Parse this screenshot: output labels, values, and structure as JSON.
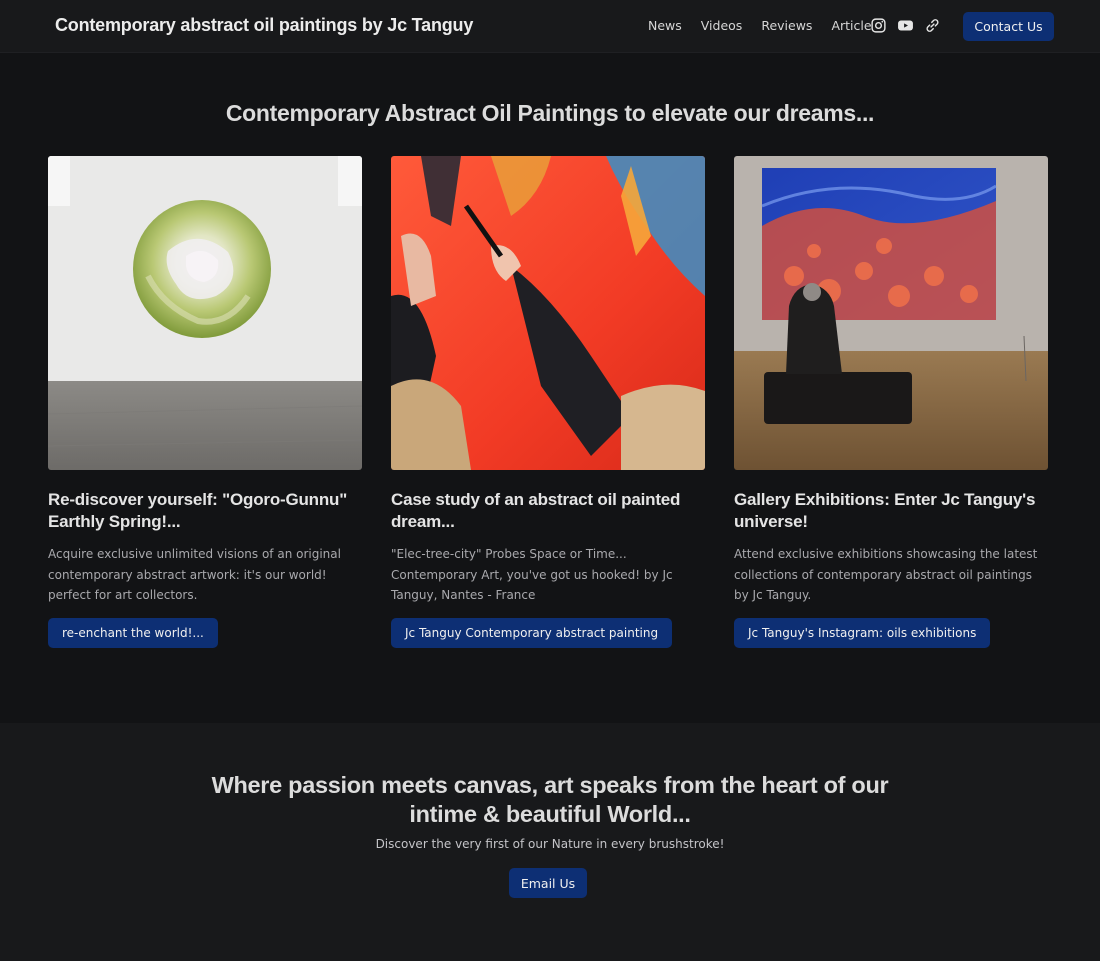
{
  "navbar": {
    "brand": "Contemporary abstract oil paintings by Jc Tanguy",
    "links": [
      "News",
      "Videos",
      "Reviews",
      "Article"
    ],
    "icons": [
      "instagram-icon",
      "youtube-icon",
      "link-icon"
    ],
    "contact_label": "Contact Us"
  },
  "hero": {
    "title": "Contemporary Abstract Oil Paintings to elevate our dreams..."
  },
  "cards": [
    {
      "title": "Re-discover yourself: \"Ogoro-Gunnu\" Earthly Spring!...",
      "text": "Acquire exclusive unlimited visions of an original contemporary abstract artwork: it's our world! perfect for art collectors.",
      "button": "re-enchant the world!..."
    },
    {
      "title": "Case study of an abstract oil painted dream...",
      "text": "\"Elec-tree-city\" Probes Space or Time... Contemporary Art, you've got us hooked! by Jc Tanguy, Nantes - France",
      "button": "Jc Tanguy Contemporary abstract painting"
    },
    {
      "title": "Gallery Exhibitions: Enter Jc Tanguy's universe!",
      "text": "Attend exclusive exhibitions showcasing the latest collections of contemporary abstract oil paintings by Jc Tanguy.",
      "button": "Jc Tanguy's Instagram: oils exhibitions"
    }
  ],
  "bottom": {
    "title": "Where passion meets canvas, art speaks from the heart of our intime & beautiful World...",
    "subtitle": "Discover the very first of our Nature in every brushstroke!",
    "button": "Email Us"
  },
  "colors": {
    "background": "#121315",
    "navbar": "#18191b",
    "accent_button": "#0d2f74"
  }
}
